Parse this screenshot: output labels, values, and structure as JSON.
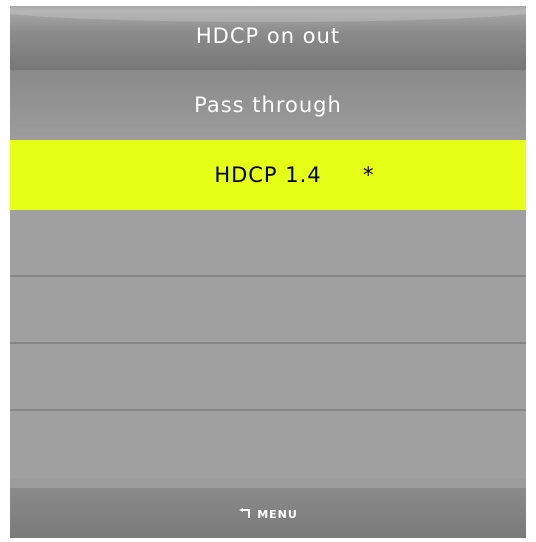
{
  "title": "HDCP on out",
  "menu": {
    "items": [
      {
        "label": "Pass through",
        "marker": ""
      },
      {
        "label": "HDCP 1.4",
        "marker": "*"
      }
    ],
    "selected_index": 1
  },
  "footer": {
    "back_label": "MENU",
    "back_icon": "back-arrow-icon"
  },
  "colors": {
    "background": "#9c9c9c",
    "selected_highlight": "#e6ff17",
    "text": "#ffffff",
    "selected_text": "#000000"
  }
}
